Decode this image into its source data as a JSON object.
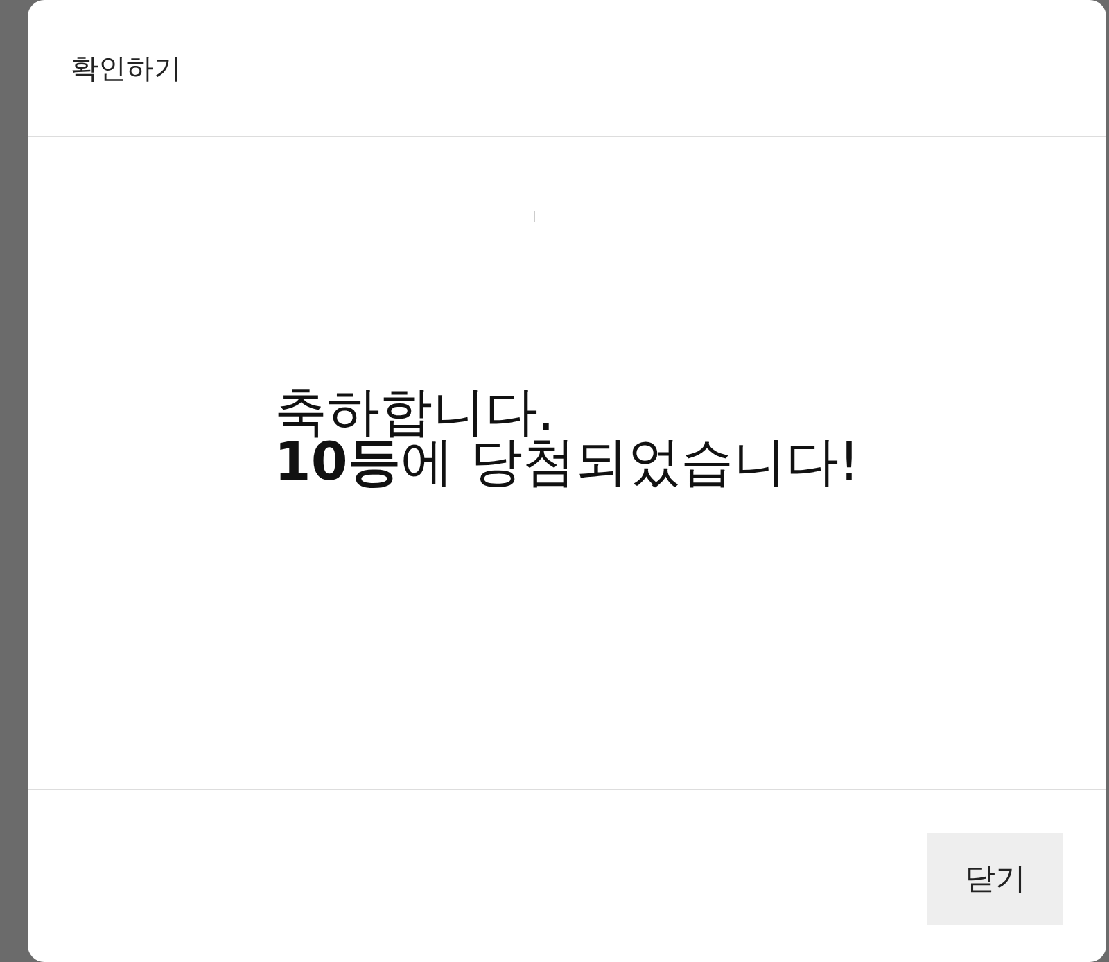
{
  "dialog": {
    "title": "확인하기",
    "message": "축하합니다.\n**10등**에 당첨되었습니다!",
    "buttons": [
      "닫기"
    ]
  }
}
